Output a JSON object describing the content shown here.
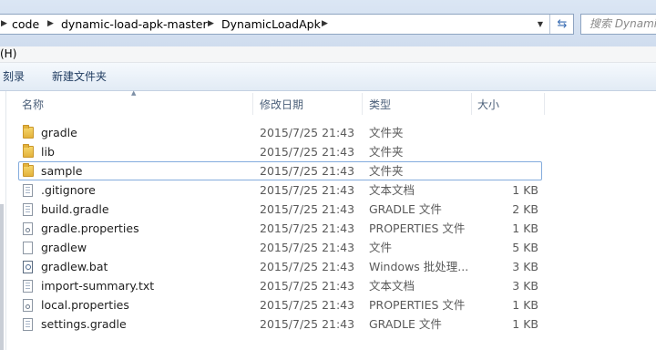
{
  "address_bar": {
    "crumbs": [
      "code",
      "dynamic-load-apk-master",
      "DynamicLoadApk"
    ],
    "search_placeholder": "搜索 DynamicLoadApk"
  },
  "menu": {
    "help": "(H)"
  },
  "toolbar": {
    "burn": "刻录",
    "new_folder": "新建文件夹"
  },
  "columns": {
    "name": "名称",
    "modified": "修改日期",
    "type": "类型",
    "size": "大小"
  },
  "files": [
    {
      "name": "gradle",
      "modified": "2015/7/25 21:43",
      "type": "文件夹",
      "size": "",
      "icon": "folder-icon"
    },
    {
      "name": "lib",
      "modified": "2015/7/25 21:43",
      "type": "文件夹",
      "size": "",
      "icon": "folder-icon"
    },
    {
      "name": "sample",
      "modified": "2015/7/25 21:43",
      "type": "文件夹",
      "size": "",
      "icon": "folder-icon"
    },
    {
      "name": ".gitignore",
      "modified": "2015/7/25 21:43",
      "type": "文本文档",
      "size": "1 KB",
      "icon": "text-file-icon"
    },
    {
      "name": "build.gradle",
      "modified": "2015/7/25 21:43",
      "type": "GRADLE 文件",
      "size": "2 KB",
      "icon": "gradle-file-icon"
    },
    {
      "name": "gradle.properties",
      "modified": "2015/7/25 21:43",
      "type": "PROPERTIES 文件",
      "size": "1 KB",
      "icon": "properties-file-icon"
    },
    {
      "name": "gradlew",
      "modified": "2015/7/25 21:43",
      "type": "文件",
      "size": "5 KB",
      "icon": "blank-file-icon"
    },
    {
      "name": "gradlew.bat",
      "modified": "2015/7/25 21:43",
      "type": "Windows 批处理...",
      "size": "3 KB",
      "icon": "batch-file-icon"
    },
    {
      "name": "import-summary.txt",
      "modified": "2015/7/25 21:43",
      "type": "文本文档",
      "size": "3 KB",
      "icon": "text-file-icon"
    },
    {
      "name": "local.properties",
      "modified": "2015/7/25 21:43",
      "type": "PROPERTIES 文件",
      "size": "1 KB",
      "icon": "properties-file-icon"
    },
    {
      "name": "settings.gradle",
      "modified": "2015/7/25 21:43",
      "type": "GRADLE 文件",
      "size": "1 KB",
      "icon": "gradle-file-icon"
    }
  ]
}
